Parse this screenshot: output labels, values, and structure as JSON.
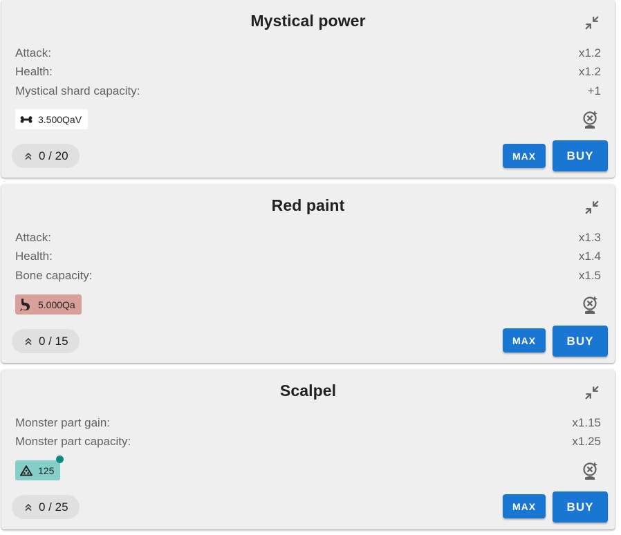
{
  "upgrades": [
    {
      "title": "Mystical power",
      "effects": [
        {
          "label": "Attack:",
          "value": "x1.2"
        },
        {
          "label": "Health:",
          "value": "x1.2"
        },
        {
          "label": "Mystical shard capacity:",
          "value": "+1"
        }
      ],
      "price": {
        "icon": "bone-icon",
        "amount": "3.500QaV",
        "color": "#ffffff"
      },
      "level": "0 / 20",
      "max_label": "MAX",
      "buy_label": "BUY"
    },
    {
      "title": "Red paint",
      "effects": [
        {
          "label": "Attack:",
          "value": "x1.3"
        },
        {
          "label": "Health:",
          "value": "x1.4"
        },
        {
          "label": "Bone capacity:",
          "value": "x1.5"
        }
      ],
      "price": {
        "icon": "stomach-icon",
        "amount": "5.000Qa",
        "color": "#d9a09b"
      },
      "level": "0 / 15",
      "max_label": "MAX",
      "buy_label": "BUY"
    },
    {
      "title": "Scalpel",
      "effects": [
        {
          "label": "Monster part gain:",
          "value": "x1.15"
        },
        {
          "label": "Monster part capacity:",
          "value": "x1.25"
        }
      ],
      "price": {
        "icon": "monster-part-pile-icon",
        "amount": "125",
        "color": "#86cfc8"
      },
      "level": "0 / 25",
      "max_label": "MAX",
      "buy_label": "BUY"
    }
  ],
  "colors": {
    "card_background": "#efefef",
    "button_primary": "#1976d2",
    "level_pill": "#e0e0e0",
    "notification_dot": "#0e8a7e"
  }
}
